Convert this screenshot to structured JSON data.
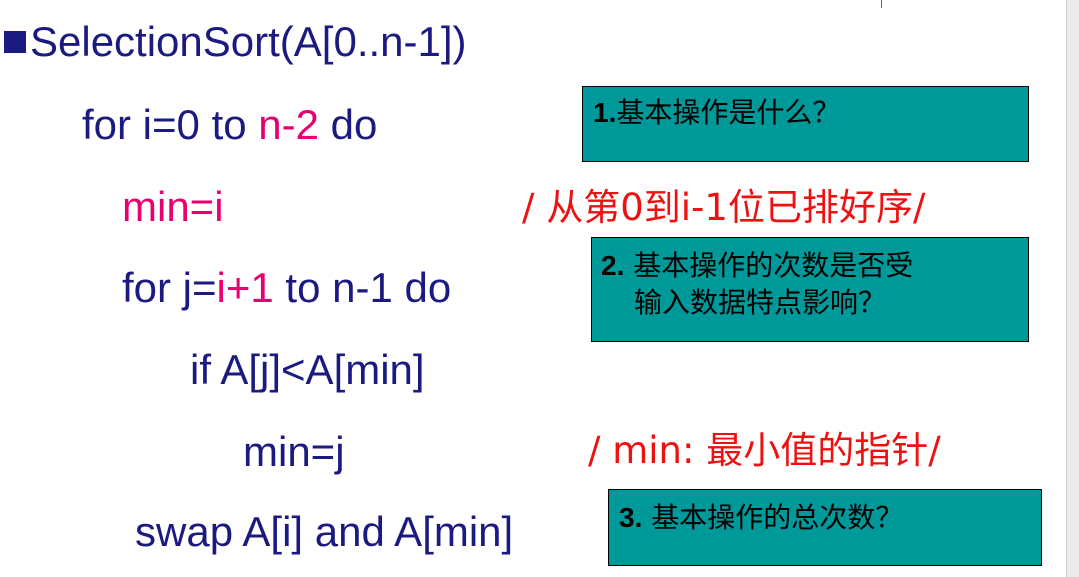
{
  "code": {
    "header": "SelectionSort(A[0..n-1])",
    "line_for_i_a": "for i=0 to ",
    "line_for_i_b": "n-2",
    "line_for_i_c": " do",
    "line_min_i": "min=i",
    "line_for_j_a": "for j=",
    "line_for_j_b": "i+1",
    "line_for_j_c": " to n-1 do",
    "line_if": "if  A[j]<A[min]",
    "line_min_j": "min=j",
    "line_swap": "swap A[i] and A[min]"
  },
  "comments": {
    "sorted_note": "/ 从第0到i-1位已排好序/",
    "min_note": "/ min: 最小值的指针/"
  },
  "questions": {
    "q1_num": "1.",
    "q1_text": "基本操作是什么？",
    "q2_num": "2.",
    "q2_text_line1": " 基本操作的次数是否受",
    "q2_text_line2": "输入数据特点影响？",
    "q3_num": "3.",
    "q3_text": " 基本操作的总次数？"
  },
  "colors": {
    "code": "#1a1a80",
    "highlight": "#e8006f",
    "comment": "#ee1111",
    "box": "#009999"
  }
}
